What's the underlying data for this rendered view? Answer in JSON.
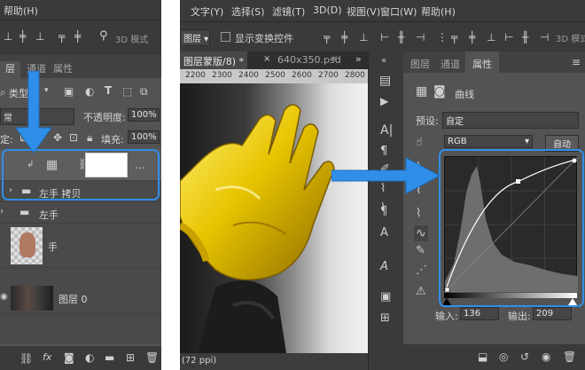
{
  "left": {
    "menu": {
      "help": "帮助(H)"
    },
    "tabs": {
      "layers": "层",
      "channels": "通道",
      "properties": "属性"
    },
    "filter_label": "类型",
    "blend_mode": "常",
    "opacity_label": "不透明度:",
    "opacity_value": "100%",
    "lock_label": "定:",
    "fill_label": "填充:",
    "fill_value": "100%",
    "layers": [
      {
        "name": "左手 拷贝"
      },
      {
        "name": "左手"
      },
      {
        "name": "手"
      },
      {
        "name": "图层 0"
      }
    ]
  },
  "right": {
    "menu": [
      "文字(Y)",
      "选择(S)",
      "滤镜(T)",
      "3D(D)",
      "视图(V)",
      "窗口(W)",
      "帮助(H)"
    ],
    "options": {
      "layer_dropdown": "图层",
      "show_transform": "显示变换控件",
      "mode_3d": "3D 模式"
    },
    "doc_tabs": [
      "图层蒙版/8) *",
      "640x350.psd"
    ],
    "ruler": [
      "2200",
      "2300",
      "2400",
      "2500",
      "2600",
      "2700",
      "2800"
    ],
    "status": "(72 ppi)",
    "panel_tabs": {
      "layers": "图层",
      "channels": "通道",
      "properties": "属性"
    },
    "curves": {
      "title": "曲线",
      "preset_label": "预设:",
      "preset_value": "自定",
      "channel": "RGB",
      "auto_label": "自动",
      "input_label": "输入:",
      "input_value": "136",
      "output_label": "输出:",
      "output_value": "209"
    }
  },
  "colors": {
    "highlight": "#2f8fe8",
    "panel": "#535353",
    "dark": "#3a3a3a",
    "gold": "#e8c400"
  }
}
